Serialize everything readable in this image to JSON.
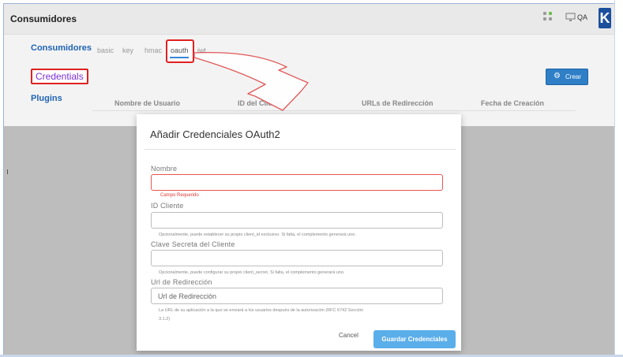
{
  "header": {
    "title": "Consumidores",
    "env_label": "QA",
    "logo_letter": "K"
  },
  "nav": {
    "consumers": "Consumidores",
    "credentials": "Credentials",
    "plugins": "Plugins"
  },
  "tabs": [
    {
      "label": "basic"
    },
    {
      "label": "key"
    },
    {
      "label": "hmac"
    },
    {
      "label": "oauth",
      "active": true
    },
    {
      "label": "jwt"
    }
  ],
  "toolbar": {
    "create_label": "Crear"
  },
  "table": {
    "headers": [
      "Nombre de Usuario",
      "ID del Cliente",
      "URLs de Redirección",
      "Fecha de Creación"
    ]
  },
  "modal": {
    "title": "Añadir Credenciales OAuth2",
    "name_label": "Nombre",
    "name_value": "",
    "name_error": "Campo Requerido",
    "client_id_label": "ID Cliente",
    "client_id_value": "",
    "client_id_help": "Opcionalmente, puede establecer su propio client_id exclusivo. Si falta, el complemento generará uno.",
    "secret_label": "Clave Secreta del Cliente",
    "secret_value": "",
    "secret_help": "Opcionalmente, puede configurar su propio client_secret. Si falta, el complemento generará uno.",
    "redirect_label": "Url de Redirección",
    "redirect_placeholder": "Url de Redirección",
    "redirect_help_1": "La URL de su aplicación a la que se enviará a los usuarios después de la autorización (RFC 6742 Sección",
    "redirect_help_2": "3.1.2)",
    "cancel_label": "Cancel",
    "save_label": "Guardar Credenciales"
  },
  "colors": {
    "accent": "#2f7fc7",
    "highlight": "#e02020",
    "save_button": "#5aaeea",
    "link": "#1f63b5"
  }
}
